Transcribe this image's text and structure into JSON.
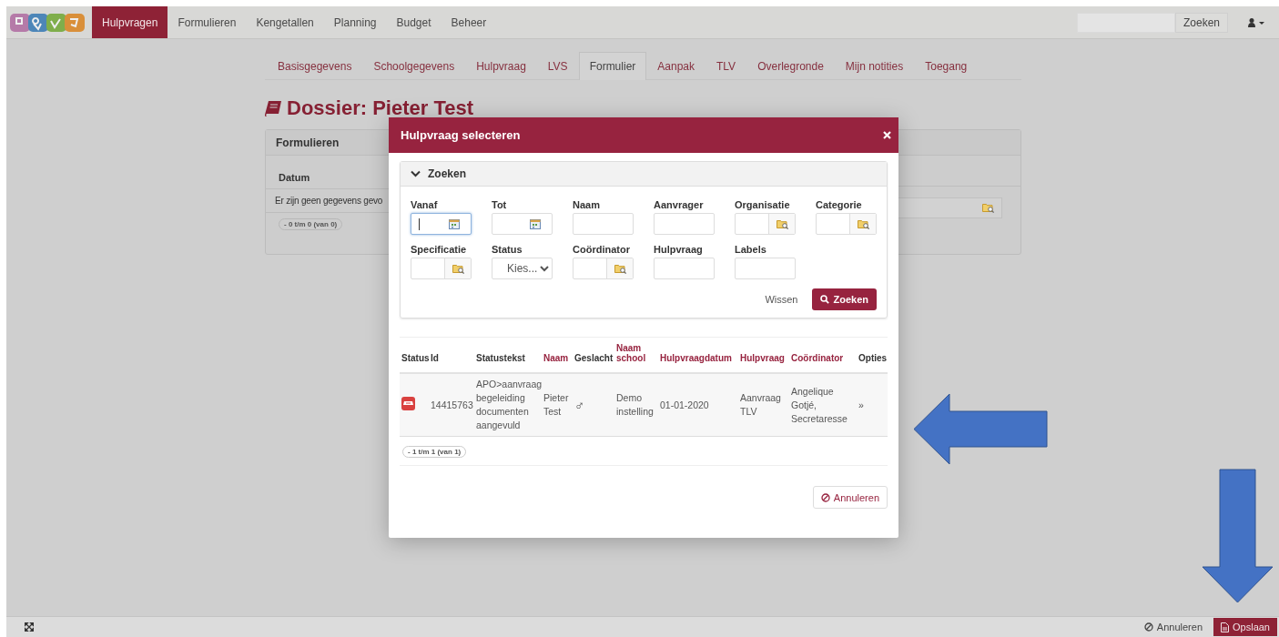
{
  "nav": {
    "items": [
      {
        "label": "Hulpvragen",
        "selected": true
      },
      {
        "label": "Formulieren",
        "selected": false
      },
      {
        "label": "Kengetallen",
        "selected": false
      },
      {
        "label": "Planning",
        "selected": false
      },
      {
        "label": "Budget",
        "selected": false
      },
      {
        "label": "Beheer",
        "selected": false
      }
    ],
    "search_button": "Zoeken"
  },
  "subtabs": [
    {
      "label": "Basisgegevens",
      "selected": false
    },
    {
      "label": "Schoolgegevens",
      "selected": false
    },
    {
      "label": "Hulpvraag",
      "selected": false
    },
    {
      "label": "LVS",
      "selected": false
    },
    {
      "label": "Formulier",
      "selected": true
    },
    {
      "label": "Aanpak",
      "selected": false
    },
    {
      "label": "TLV",
      "selected": false
    },
    {
      "label": "Overlegronde",
      "selected": false
    },
    {
      "label": "Mijn notities",
      "selected": false
    },
    {
      "label": "Toegang",
      "selected": false
    }
  ],
  "title": "Dossier: Pieter Test",
  "left_panel": {
    "title": "Formulieren",
    "column": "Datum",
    "empty_text": "Er zijn geen gegevens gevo",
    "pager": "- 0 t/m 0 (van 0)"
  },
  "modal": {
    "title": "Hulpvraag selecteren",
    "search": {
      "title": "Zoeken",
      "expanded": true,
      "fields": [
        {
          "label": "Vanaf",
          "kind": "date",
          "focused": true
        },
        {
          "label": "Tot",
          "kind": "date",
          "focused": false
        },
        {
          "label": "Naam",
          "kind": "text",
          "focused": false
        },
        {
          "label": "Aanvrager",
          "kind": "text",
          "focused": false
        },
        {
          "label": "Organisatie",
          "kind": "lookup",
          "focused": false
        },
        {
          "label": "Categorie",
          "kind": "lookup",
          "focused": false
        },
        {
          "label": "Specificatie",
          "kind": "lookup",
          "focused": false
        },
        {
          "label": "Status",
          "kind": "select",
          "value": "Kies...",
          "focused": false
        },
        {
          "label": "Coördinator",
          "kind": "lookup",
          "focused": false
        },
        {
          "label": "Hulpvraag",
          "kind": "text",
          "focused": false
        },
        {
          "label": "Labels",
          "kind": "text",
          "focused": false
        }
      ],
      "clear": "Wissen",
      "submit": "Zoeken"
    },
    "table": {
      "columns": [
        {
          "label": "Status",
          "sortable": false
        },
        {
          "label": "Id",
          "sortable": false
        },
        {
          "label": "Statustekst",
          "sortable": false
        },
        {
          "label": "Naam",
          "sortable": true
        },
        {
          "label": "Geslacht",
          "sortable": false
        },
        {
          "label": "Naam school",
          "sortable": true
        },
        {
          "label": "Hulpvraagdatum",
          "sortable": true
        },
        {
          "label": "Hulpvraag",
          "sortable": true
        },
        {
          "label": "Coördinator",
          "sortable": true
        },
        {
          "label": "Opties",
          "sortable": false
        }
      ],
      "rows": [
        {
          "cells": [
            "",
            "14415763",
            "APO>aanvraag begeleiding documenten aangevuld",
            "Pieter Test",
            "♂",
            "Demo instelling",
            "01-01-2020",
            "Aanvraag TLV",
            "Angelique Gotjé, Secretaresse",
            "»"
          ]
        }
      ]
    },
    "pager": "- 1 t/m 1 (van 1)",
    "cancel": "Annuleren"
  },
  "footer": {
    "cancel": "Annuleren",
    "save": "Opslaan"
  }
}
